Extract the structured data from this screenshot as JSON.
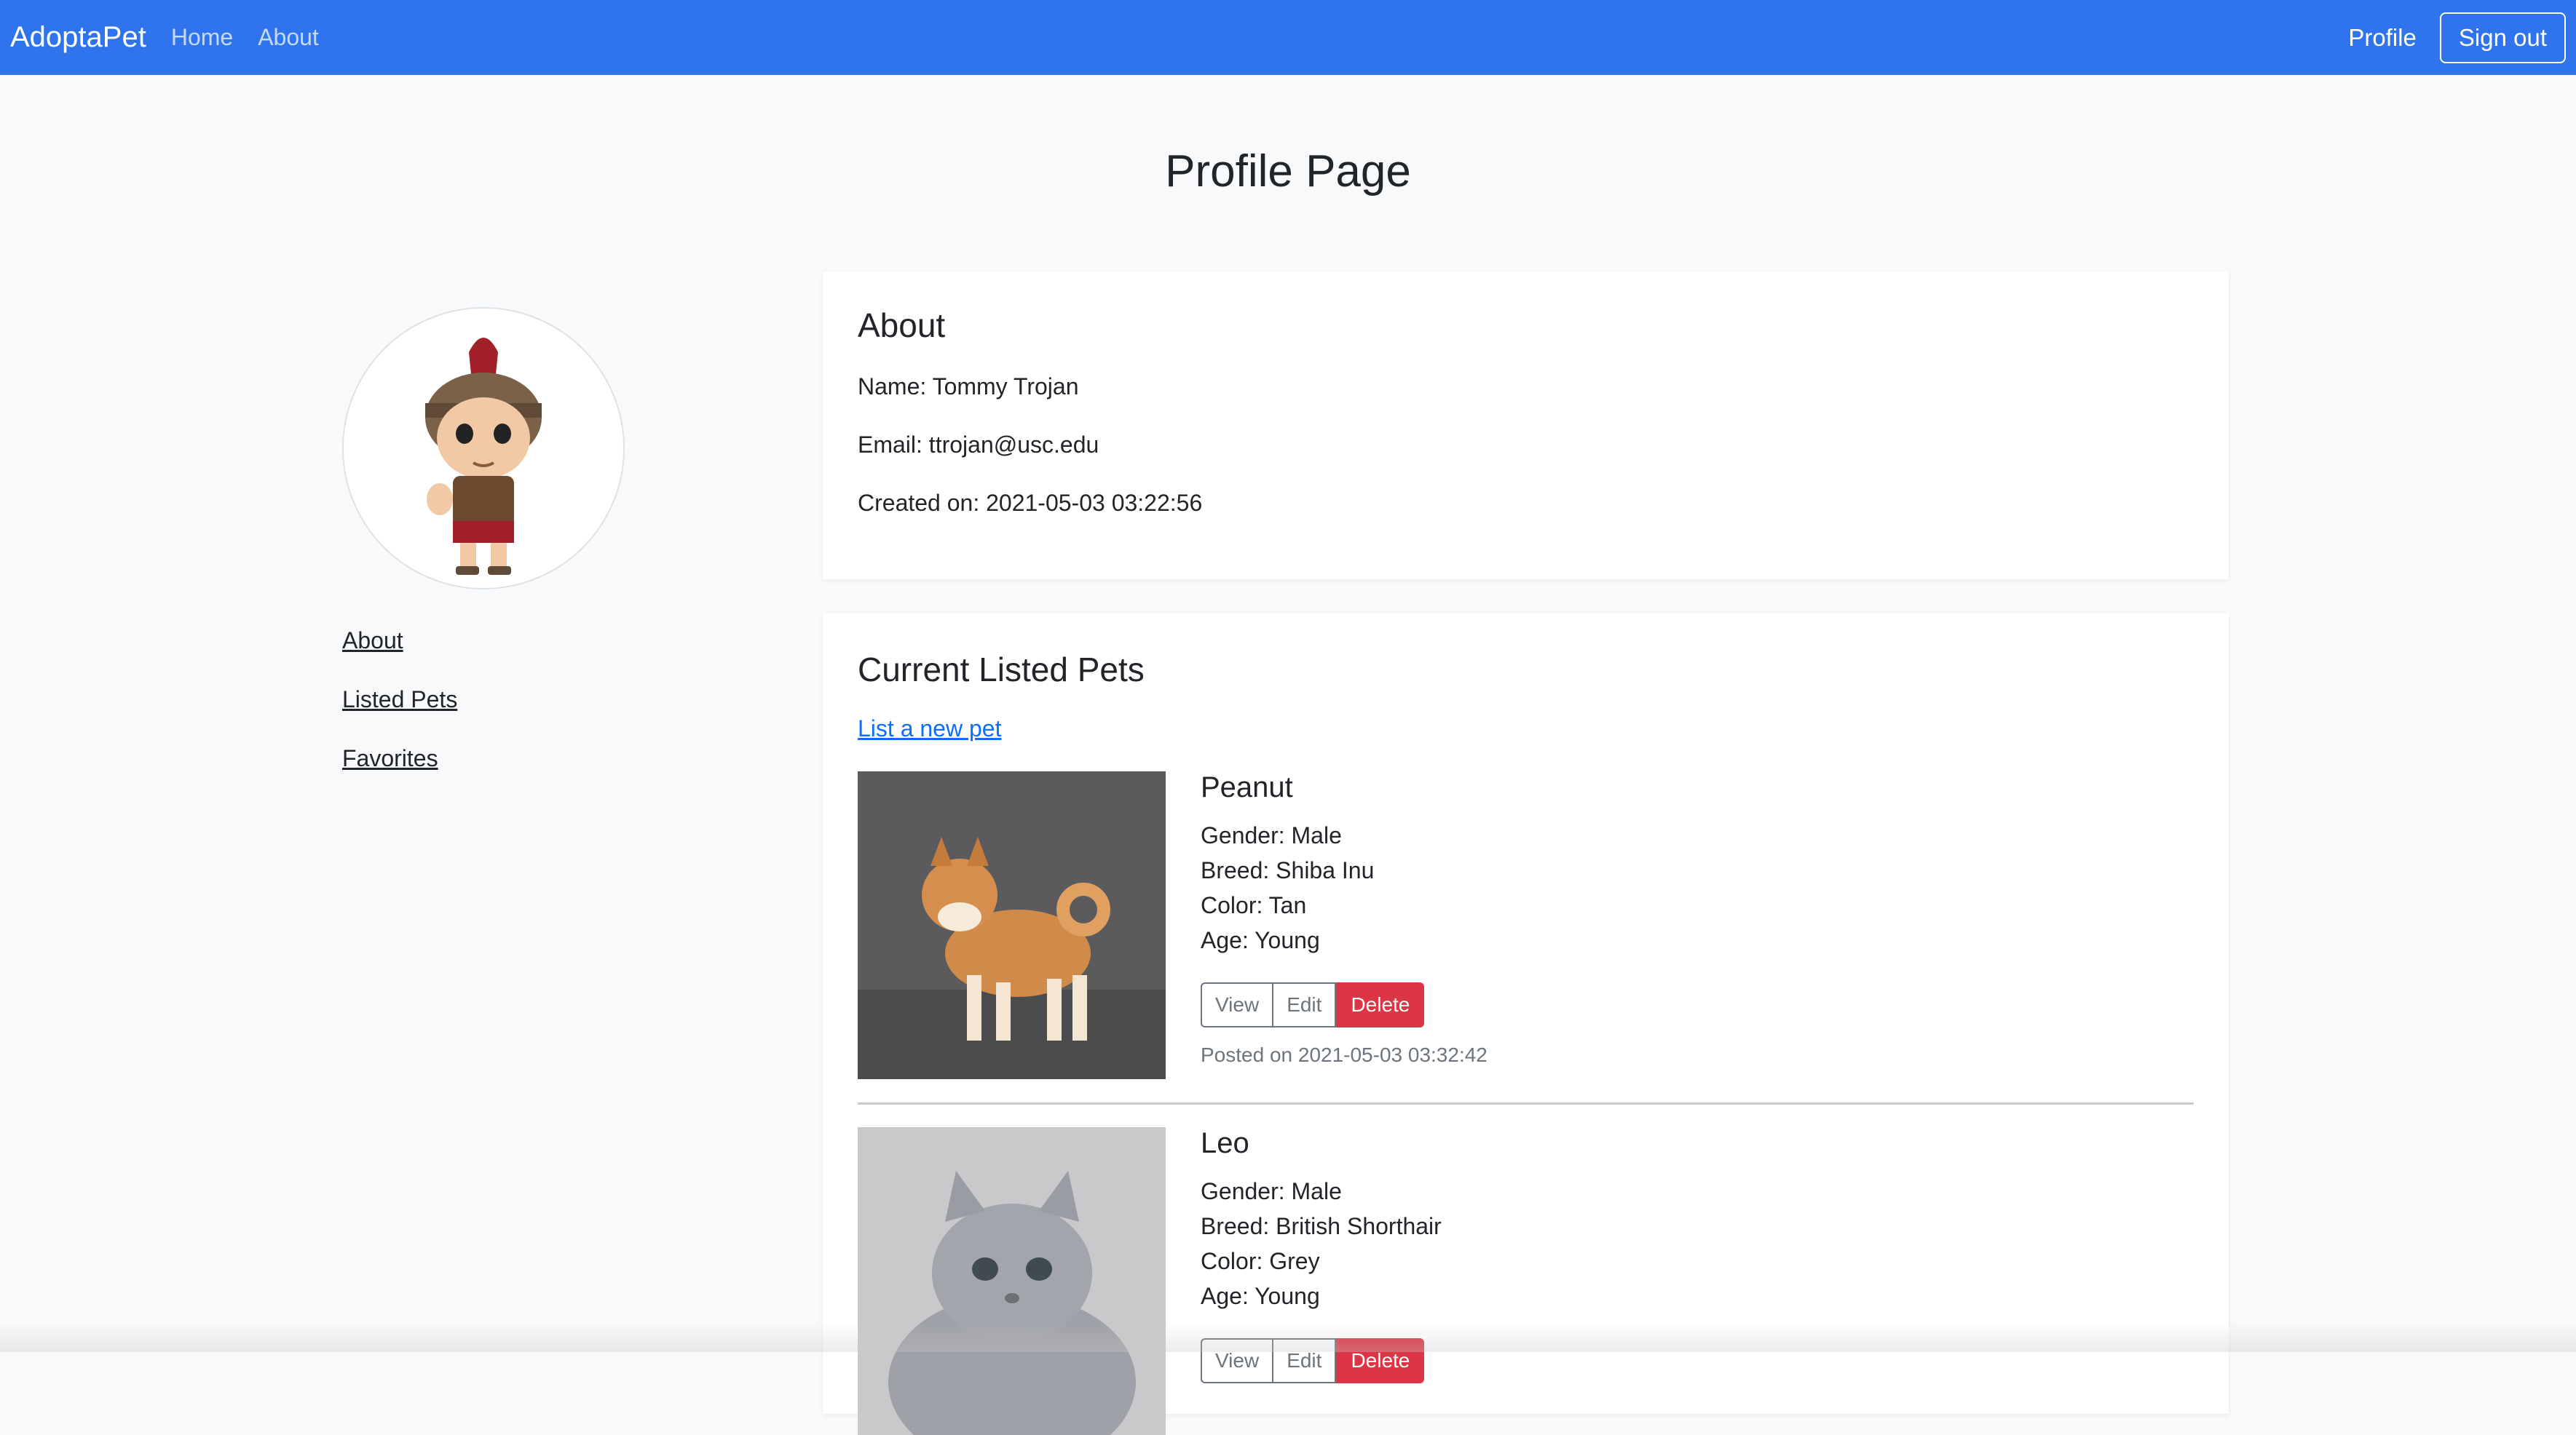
{
  "nav": {
    "brand": "AdoptaPet",
    "links": [
      "Home",
      "About"
    ],
    "profile": "Profile",
    "signout": "Sign out"
  },
  "page": {
    "title": "Profile Page"
  },
  "sidebar": {
    "items": [
      "About",
      "Listed Pets",
      "Favorites"
    ]
  },
  "about": {
    "heading": "About",
    "name": "Name: Tommy Trojan",
    "email": "Email: ttrojan@usc.edu",
    "created": "Created on: 2021-05-03 03:22:56"
  },
  "pets": {
    "heading": "Current Listed Pets",
    "new_link": "List a new pet",
    "buttons": {
      "view": "View",
      "edit": "Edit",
      "delete": "Delete"
    },
    "items": [
      {
        "name": "Peanut",
        "gender": "Gender: Male",
        "breed": "Breed: Shiba Inu",
        "color": "Color: Tan",
        "age": "Age: Young",
        "posted": "Posted on 2021-05-03 03:32:42"
      },
      {
        "name": "Leo",
        "gender": "Gender: Male",
        "breed": "Breed: British Shorthair",
        "color": "Color: Grey",
        "age": "Age: Young"
      }
    ]
  },
  "colors": {
    "navbar": "#2f74ec",
    "delete": "#dc3545",
    "link": "#0d6efd"
  }
}
